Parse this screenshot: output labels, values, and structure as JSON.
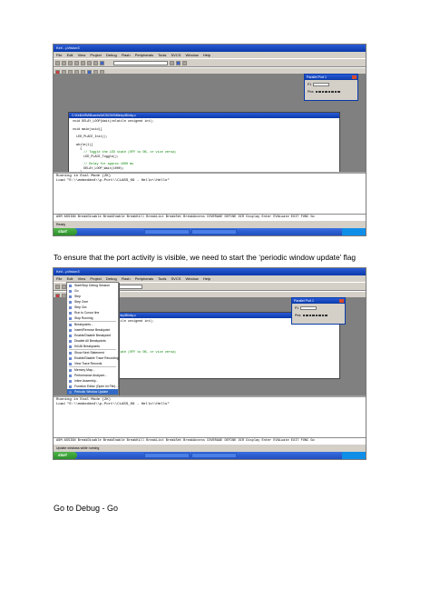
{
  "shot1": {
    "window_title": "Keil - µVision3",
    "menu": [
      "File",
      "Edit",
      "View",
      "Project",
      "Debug",
      "Flash",
      "Peripherals",
      "Tools",
      "SVCS",
      "Window",
      "Help"
    ],
    "editor_title": "C:\\Keil\\ARM\\Boards\\MCB2300\\Blinky\\Blinky.c",
    "code": [
      "void DELAY_LOOP(Wait(volatile unsigned int);",
      "",
      "void main(void){",
      "",
      "  LED_PLACE_Init();",
      "",
      "  while(1){",
      "    {",
      "      // Toggle the LED state (OFF to ON, or vice versa)",
      "      LED_PLACE_Toggle();",
      "",
      "      // Delay for approx 1000 ms",
      "      DELAY_LOOP_Wait(1000);",
      "    }",
      "  }",
      "}"
    ],
    "output": [
      "Running in Eval Mode (2K)",
      "Load \"E:\\\\embedded\\\\p-Port\\\\CLASS_09 - Hello\\\\Hello\""
    ],
    "command": "ASM ASSIGN BreakDisable BreakEnable BreakKill BreakList BreakSet BreakAccess COVERAGE DEFINE DIR Display Enter EVALuate EXIT FUNC Go",
    "status": "Ready",
    "port_title": "Parallel Port 1",
    "port_rows": [
      "P1",
      "Pins"
    ],
    "task_start": "start"
  },
  "caption1": "To ensure that the port activity is visible, we need to start the ‘periodic window update’ flag",
  "shot2": {
    "menu_items": [
      "Start/Stop Debug Session",
      "Go",
      "Step",
      "Step Over",
      "Step Out",
      "Run to Cursor line",
      "Stop Running",
      "Breakpoints...",
      "Insert/Remove Breakpoint",
      "Enable/Disable Breakpoint",
      "Disable All Breakpoints",
      "Kill All Breakpoints",
      "Show Next Statement",
      "Enable/Disable Trace Recording",
      "View Trace Records",
      "Memory Map...",
      "Performance Analyzer...",
      "Inline Assembly...",
      "Function Editor (Open Ini File)...",
      "Periodic Window Update"
    ],
    "highlighted_index": 19,
    "status": "Update windows while running"
  },
  "caption2": "Go to Debug - Go"
}
